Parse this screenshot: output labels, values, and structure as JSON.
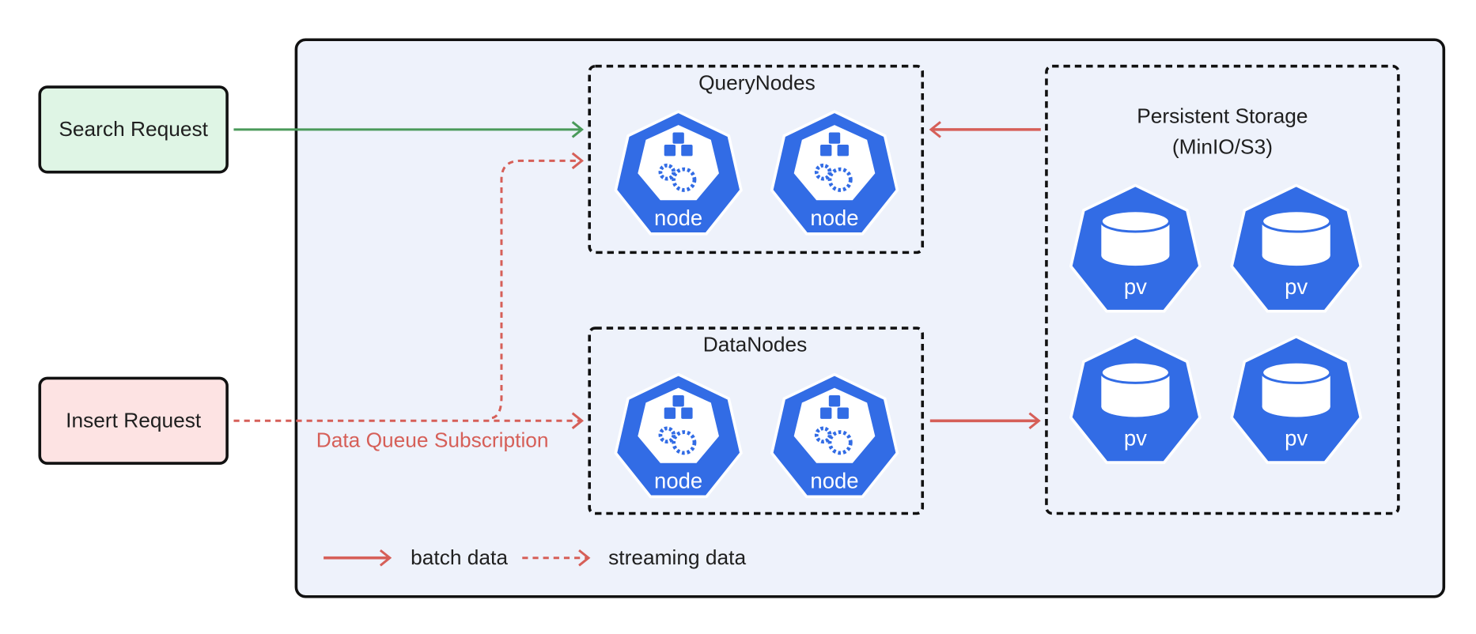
{
  "requests": {
    "search": "Search Request",
    "insert": "Insert Request"
  },
  "groups": {
    "query_nodes": "QueryNodes",
    "data_nodes": "DataNodes",
    "storage_title": "Persistent Storage",
    "storage_subtitle": "(MinIO/S3)"
  },
  "icons": {
    "node_label": "node",
    "pv_label": "pv"
  },
  "edge_labels": {
    "data_queue": "Data Queue Subscription"
  },
  "legend": {
    "batch": "batch data",
    "streaming": "streaming data"
  },
  "colors": {
    "search_fill": "#dff5e5",
    "insert_fill": "#fde3e3",
    "container_fill": "#eef2fb",
    "k8s_blue": "#326ce5",
    "green_arrow": "#4a9a5a",
    "red_arrow": "#d65f58"
  }
}
